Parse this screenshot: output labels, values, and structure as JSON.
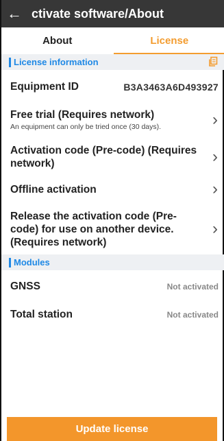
{
  "header": {
    "title": "ctivate software/About",
    "back_icon": "arrow-left-icon"
  },
  "tabs": [
    {
      "label": "About",
      "active": false
    },
    {
      "label": "License",
      "active": true
    }
  ],
  "license_section": {
    "title": "License information",
    "copy_icon": "copy-icon",
    "equipment_id": {
      "label": "Equipment ID",
      "value": "B3A3463A6D493927"
    },
    "items": [
      {
        "title": "Free trial (Requires network)",
        "subtitle": "An equipment can only be tried once (30 days)."
      },
      {
        "title": "Activation code (Pre-code) (Requires network)"
      },
      {
        "title": "Offline activation"
      },
      {
        "title": "Release the activation code (Pre-code) for use on another device. (Requires network)"
      }
    ]
  },
  "modules_section": {
    "title": "Modules",
    "modules": [
      {
        "name": "GNSS",
        "status": "Not activated"
      },
      {
        "name": "Total station",
        "status": "Not activated"
      }
    ]
  },
  "footer": {
    "update_label": "Update license"
  },
  "colors": {
    "accent": "#f3962b",
    "section_blue": "#1e88e5",
    "topbar": "#373737"
  }
}
